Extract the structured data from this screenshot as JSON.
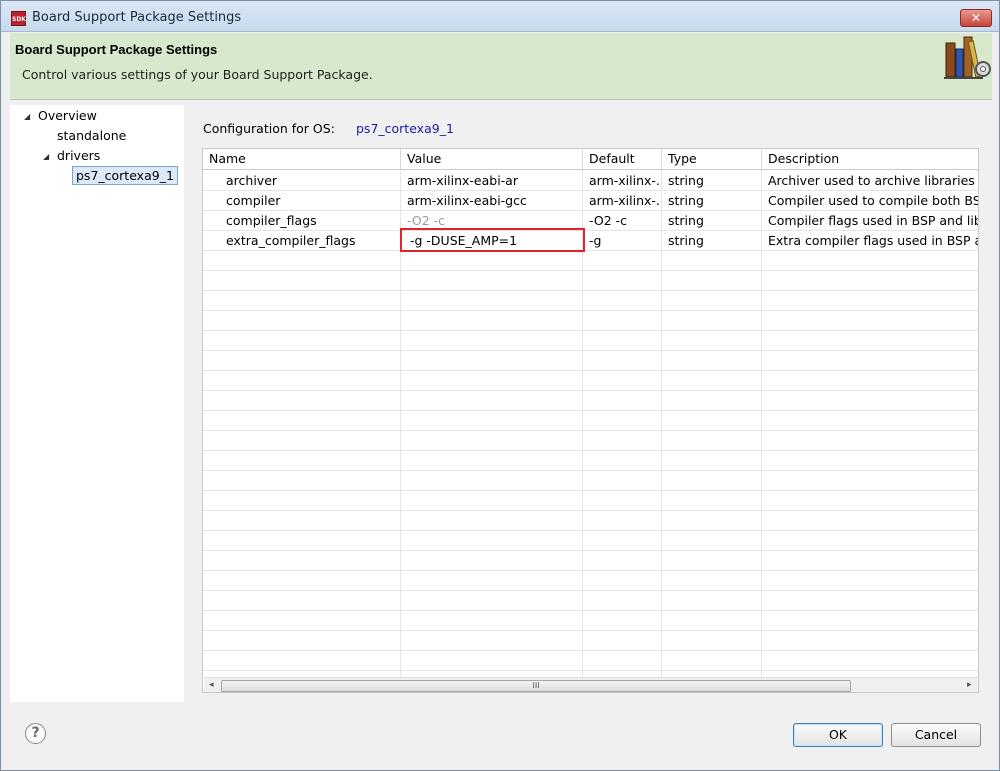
{
  "window": {
    "title": "Board Support Package Settings",
    "app_icon_text": "SDK",
    "close_glyph": "✕"
  },
  "banner": {
    "title": "Board Support Package Settings",
    "subtitle": "Control various settings of your Board Support Package.",
    "icon": "books-gear-icon"
  },
  "tree": {
    "items": [
      {
        "label": "Overview",
        "expanded": true
      },
      {
        "label": "standalone"
      },
      {
        "label": "drivers",
        "expanded": true
      },
      {
        "label": "ps7_cortexa9_1",
        "selected": true
      }
    ],
    "toggle_glyph": "◢"
  },
  "config": {
    "label": "Configuration for OS:",
    "value": "ps7_cortexa9_1"
  },
  "table": {
    "columns": [
      "Name",
      "Value",
      "Default",
      "Type",
      "Description"
    ],
    "rows": [
      {
        "name": "archiver",
        "value": "arm-xilinx-eabi-ar",
        "default": "arm-xilinx-...",
        "type": "string",
        "description": "Archiver used to archive libraries for"
      },
      {
        "name": "compiler",
        "value": "arm-xilinx-eabi-gcc",
        "default": "arm-xilinx-...",
        "type": "string",
        "description": "Compiler used to compile both BSP"
      },
      {
        "name": "compiler_flags",
        "value": "-O2 -c",
        "default": "-O2 -c",
        "type": "string",
        "description": "Compiler flags used in BSP and libra"
      },
      {
        "name": "extra_compiler_flags",
        "value": "-g -DUSE_AMP=1",
        "default": "-g",
        "type": "string",
        "description": "Extra compiler flags used in BSP and"
      }
    ],
    "scroll_left": "◂",
    "scroll_right": "▸",
    "scroll_grip": "III"
  },
  "buttons": {
    "help": "?",
    "ok": "OK",
    "cancel": "Cancel"
  },
  "colors": {
    "banner_bg": "#d8e8cc",
    "highlight": "#e0242c",
    "link_blue": "#1a1aa6"
  }
}
